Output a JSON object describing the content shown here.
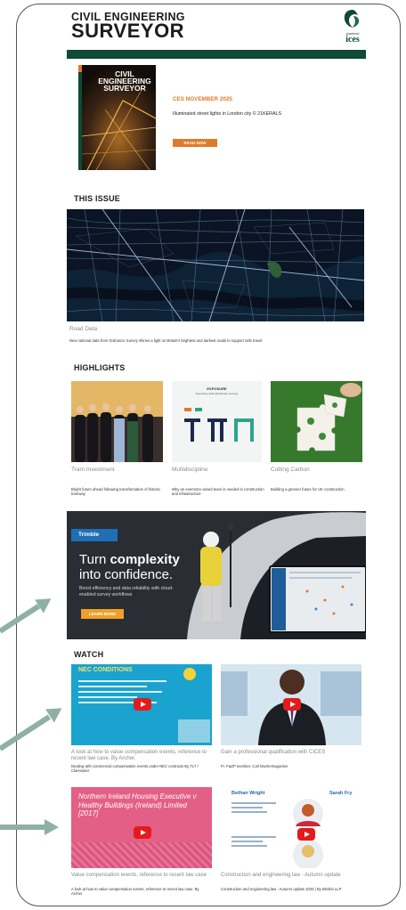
{
  "header": {
    "brand_line1": "CIVIL ENGINEERING",
    "brand_line2": "SURVEYOR",
    "logo_small": "chartered",
    "logo_text": "ices"
  },
  "hero": {
    "cover_line1": "CIVIL",
    "cover_line2": "ENGINEERING",
    "cover_line3": "SURVEYOR",
    "issue": "CES NOVEMBER 2025",
    "caption": "Illuminated street lights in London city © 21KERALS",
    "button": "READ NOW"
  },
  "this_issue": {
    "heading": "THIS ISSUE",
    "title": "Road Data",
    "text": "New national data from Ordnance Survey shines a light on Britain's brightest and darkest roads to support safe travel"
  },
  "highlights": {
    "heading": "HIGHLIGHTS",
    "items": [
      {
        "title": "Tram Investment",
        "text": "Bright future ahead following transformation of historic tramway"
      },
      {
        "title": "Multidiscipline",
        "text": "Why an evermore varied team is needed in construction and infrastructure"
      },
      {
        "title": "Cutting Carbon",
        "text": "Building a greener future for UK construction"
      }
    ],
    "chart_title": "EXPOSURE",
    "chart_sub": "Improving multi-disciplinary surveys"
  },
  "ad": {
    "brand": "Trimble",
    "line1a": "Turn ",
    "line1b": "complexity",
    "line2": "into confidence.",
    "body": "Boost efficiency and data reliability with cloud-enabled survey workflows",
    "button": "LEARN MORE"
  },
  "watch": {
    "heading": "WATCH",
    "videos": [
      {
        "title": "A look at how to value compensation events, reference to recent law case. By Archer.",
        "text": "Dealing with commercial compensation events under NEC contracts By TLT / Clarewater",
        "thumb_title": "NEC CONDITIONS"
      },
      {
        "title": "Gain a professional qualification with CICES",
        "text": "Ft. F&ZP member, Carl Muchemaguntee"
      },
      {
        "title": "Value compensation events, reference to recent law case",
        "text": "A look at how to value compensation events, reference to recent law case. By Archer",
        "thumb_title": "Northern Ireland Housing Executive v Healthy Buildings (Ireland) Limited [2017]"
      },
      {
        "title": "Construction and engineering law - Autumn update",
        "text": "Construction and engineering law - Autumn update 2025 | By Brinklo LLP",
        "person1": "Bethan Wright",
        "person2": "Sarah Fry"
      }
    ]
  },
  "colors": {
    "brand_green": "#0e4a35",
    "orange": "#e07a2a",
    "youtube_red": "#e31b1b",
    "arrow": "#8fb0a6"
  }
}
